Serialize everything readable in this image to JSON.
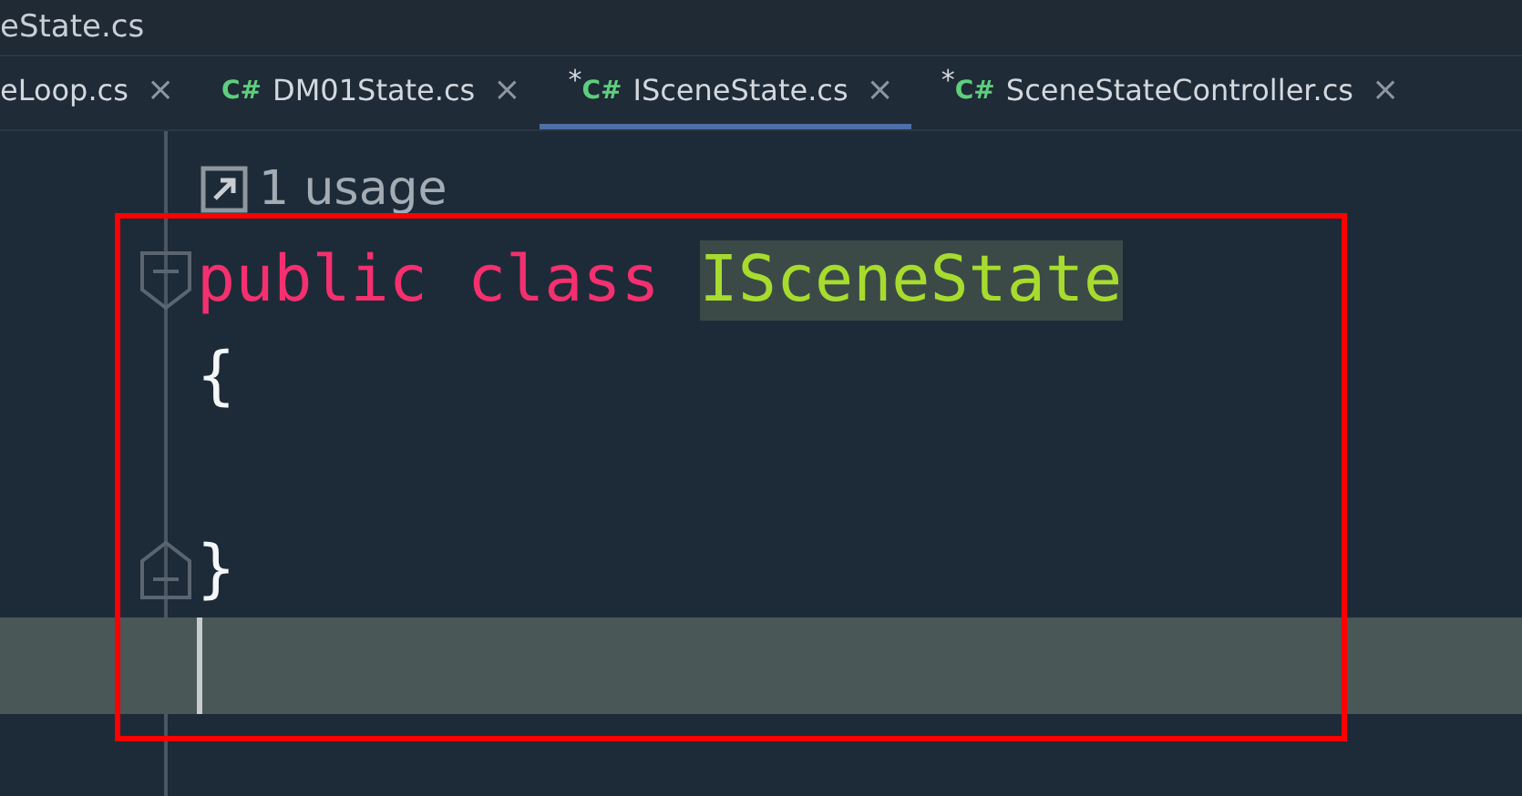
{
  "window": {
    "title": "eState.cs"
  },
  "tabs": [
    {
      "label": "eLoop.cs",
      "close": "×",
      "selected": false
    },
    {
      "icon": "C#",
      "label": "DM01State.cs",
      "close": "×",
      "selected": false
    },
    {
      "modified_mark": "*",
      "icon": "C#",
      "label": "ISceneState.cs",
      "close": "×",
      "selected": true
    },
    {
      "modified_mark": "*",
      "icon": "C#",
      "label": "SceneStateController.cs",
      "close": "×",
      "selected": false
    }
  ],
  "usage_hint": "1 usage",
  "lines": [
    {
      "fold_start": true,
      "fold_end": false,
      "current": false,
      "tokens": [
        {
          "text": "public",
          "kind": "keyword"
        },
        {
          "text": "class",
          "kind": "keyword"
        },
        {
          "text": "ISceneState",
          "kind": "type-highlighted"
        }
      ]
    },
    {
      "fold_start": false,
      "fold_end": false,
      "current": false,
      "tokens": [
        {
          "text": "{",
          "kind": "punct"
        }
      ]
    },
    {
      "fold_start": false,
      "fold_end": false,
      "current": false
    },
    {
      "fold_start": false,
      "fold_end": true,
      "current": false,
      "tokens": [
        {
          "text": "}",
          "kind": "punct"
        }
      ]
    },
    {
      "fold_start": false,
      "fold_end": false,
      "current": true
    }
  ]
}
